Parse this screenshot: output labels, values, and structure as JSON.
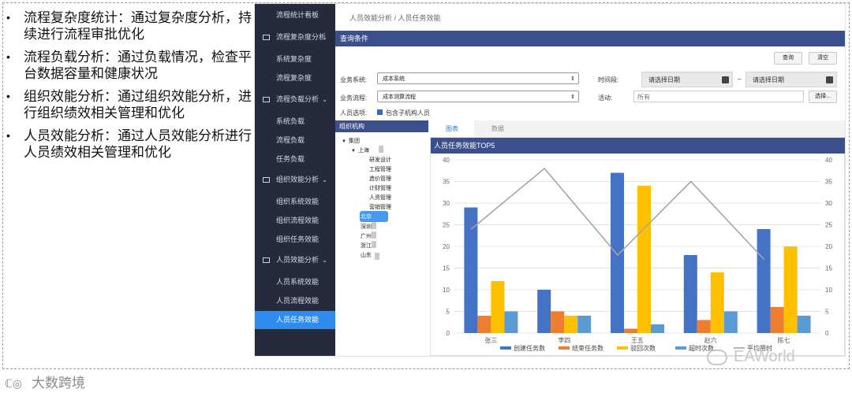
{
  "bullets": [
    "流程复杂度统计：通过复杂度分析，持续进行流程审批优化",
    "流程负载分析：通过负载情况，检查平台数据容量和健康状况",
    "组织效能分析：通过组织效能分析，进行组织绩效相关管理和优化",
    "人员效能分析：通过人员效能分析进行人员绩效相关管理和优化"
  ],
  "sidebar": {
    "top_item": "流程统计看板",
    "groups": [
      {
        "label": "流程复杂度分析",
        "items": [
          "系统复杂度",
          "流程复杂度"
        ]
      },
      {
        "label": "流程负载分析",
        "items": [
          "系统负载",
          "流程负载",
          "任务负载"
        ]
      },
      {
        "label": "组织效能分析",
        "items": [
          "组织系统效能",
          "组织流程效能",
          "组织任务效能"
        ]
      },
      {
        "label": "人员效能分析",
        "items": [
          "人员系统效能",
          "人员流程效能",
          "人员任务效能"
        ]
      }
    ]
  },
  "breadcrumb": "人员效能分析 / 人员任务效能",
  "query": {
    "title": "查询条件",
    "search_btn": "查询",
    "clear_btn": "清空",
    "system_label": "业务系统:",
    "system_value": "成本系统",
    "flow_label": "业务流程:",
    "flow_value": "成本测算流程",
    "time_label": "时间段:",
    "date_start": "请选择日期",
    "date_sep": "–",
    "date_end": "请选择日期",
    "activity_label": "活动:",
    "activity_placeholder": "所有",
    "select_btn": "选择...",
    "person_label": "人员选项:",
    "include_sub": "包含子机构人员"
  },
  "tree": {
    "title": "组织机构",
    "root": "集团",
    "child": "上海",
    "departments": [
      "研发设计",
      "工程管理",
      "造价管理",
      "计财管理",
      "人资管理",
      "营销管理"
    ],
    "others": [
      "北京",
      "深圳",
      "广州",
      "浙江",
      "山东"
    ]
  },
  "tabs": [
    "图表",
    "数据"
  ],
  "chart_data": {
    "type": "bar",
    "title": "人员任务效能TOP5",
    "categories": [
      "张三",
      "李四",
      "王五",
      "赵六",
      "陈七"
    ],
    "series": [
      {
        "name": "创建任务数",
        "values": [
          29,
          10,
          37,
          18,
          24
        ],
        "color": "#4472c4"
      },
      {
        "name": "结束任务数",
        "values": [
          4,
          5,
          1,
          3,
          6
        ],
        "color": "#ed7d31"
      },
      {
        "name": "驳回次数",
        "values": [
          12,
          4,
          34,
          14,
          20
        ],
        "color": "#ffc000"
      },
      {
        "name": "超时次数",
        "values": [
          5,
          4,
          2,
          5,
          4
        ],
        "color": "#5b9bd5"
      }
    ],
    "line_series": {
      "name": "平均用时",
      "values": [
        24,
        38,
        18,
        35,
        17
      ],
      "color": "#a5a5a5"
    },
    "ylim": [
      0,
      40
    ],
    "yticks": [
      0,
      5,
      10,
      15,
      20,
      25,
      30,
      35,
      40
    ],
    "legend_position": "bottom"
  },
  "footer": {
    "logo_text": "大数跨境",
    "watermark": "EAWorld"
  }
}
